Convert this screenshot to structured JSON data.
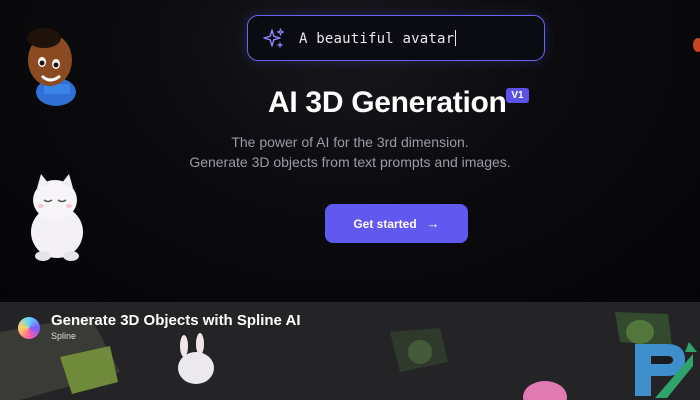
{
  "prompt": {
    "text": "A beautiful avatar",
    "icon": "sparkle-icon"
  },
  "hero": {
    "title": "AI 3D Generation",
    "badge": "V1",
    "subtitle_line1": "The power of AI for the 3rd dimension.",
    "subtitle_line2": "Generate 3D objects from text prompts and images.",
    "cta_label": "Get started",
    "cta_icon": "→"
  },
  "video": {
    "title": "Generate 3D Objects with Spline AI",
    "channel": "Spline"
  },
  "colors": {
    "accent": "#6158ef",
    "background": "#060608",
    "badge": "#5b52e8"
  }
}
